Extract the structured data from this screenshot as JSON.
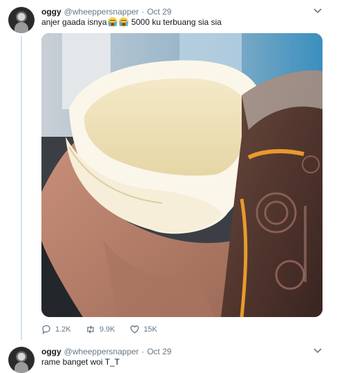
{
  "tweets": [
    {
      "display_name": "oggy",
      "handle": "@wheeppersnapper",
      "separator": "·",
      "time": "Oct 29",
      "text_before": "anjer gaada isnya",
      "emojis": [
        "loudly-crying-face-emoji",
        "loudly-crying-face-emoji"
      ],
      "text_after": " 5000 ku terbuang sia sia",
      "actions": {
        "replies": "1.2K",
        "retweets": "9.9K",
        "likes": "15K"
      }
    },
    {
      "display_name": "oggy",
      "handle": "@wheeppersnapper",
      "separator": "·",
      "time": "Oct 29",
      "text": "rame banget woi T_T"
    }
  ],
  "colors": {
    "text_primary": "#14171a",
    "text_secondary": "#657786",
    "thread_line": "#cce3f5"
  }
}
